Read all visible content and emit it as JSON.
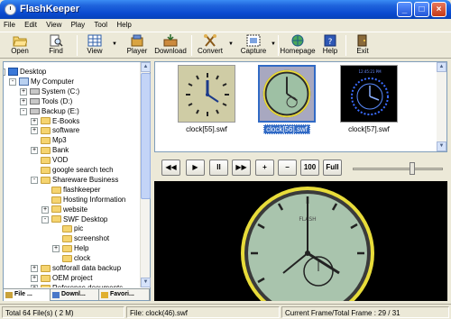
{
  "window": {
    "title": "FlashKeeper"
  },
  "menu": [
    "File",
    "Edit",
    "View",
    "Play",
    "Tool",
    "Help"
  ],
  "toolbar": {
    "open": "Open",
    "find": "Find",
    "view": "View",
    "player": "Player",
    "download": "Download",
    "convert": "Convert",
    "capture": "Capture",
    "homepage": "Homepage",
    "help": "Help",
    "exit": "Exit"
  },
  "tree": [
    {
      "label": "Desktop",
      "icon": "desktop-icon",
      "expand": "-"
    },
    {
      "label": "My Computer",
      "icon": "computer-icon",
      "expand": "-"
    },
    {
      "label": "System (C:)",
      "icon": "drive-icon",
      "expand": "+"
    },
    {
      "label": "Tools (D:)",
      "icon": "drive-icon",
      "expand": "+"
    },
    {
      "label": "Backup (E:)",
      "icon": "drive-icon",
      "expand": "-"
    },
    {
      "label": "E-Books",
      "icon": "folder-icon",
      "expand": "+"
    },
    {
      "label": "software",
      "icon": "folder-icon",
      "expand": "+"
    },
    {
      "label": "Mp3",
      "icon": "folder-icon",
      "expand": ""
    },
    {
      "label": "Bank",
      "icon": "folder-icon",
      "expand": "+"
    },
    {
      "label": "VOD",
      "icon": "folder-icon",
      "expand": ""
    },
    {
      "label": "google search tech",
      "icon": "folder-icon",
      "expand": ""
    },
    {
      "label": "Shareware Business",
      "icon": "folder-icon",
      "expand": "-"
    },
    {
      "label": "flashkeeper",
      "icon": "folder-icon",
      "expand": ""
    },
    {
      "label": "Hosting Information",
      "icon": "folder-icon",
      "expand": ""
    },
    {
      "label": "website",
      "icon": "folder-icon",
      "expand": "+"
    },
    {
      "label": "SWF Desktop",
      "icon": "folder-icon",
      "expand": "-"
    },
    {
      "label": "pic",
      "icon": "folder-icon",
      "expand": ""
    },
    {
      "label": "screenshot",
      "icon": "folder-icon",
      "expand": ""
    },
    {
      "label": "Help",
      "icon": "folder-icon",
      "expand": "+"
    },
    {
      "label": "clock",
      "icon": "folder-icon",
      "expand": ""
    },
    {
      "label": "softforall data backup",
      "icon": "folder-icon",
      "expand": "+"
    },
    {
      "label": "OEM project",
      "icon": "folder-icon",
      "expand": "+"
    },
    {
      "label": "Reference documents",
      "icon": "folder-icon",
      "expand": "+"
    }
  ],
  "tabs": [
    "File ...",
    "Downl...",
    "Favori..."
  ],
  "thumbnails": [
    {
      "label": "clock[55].swf",
      "selected": false
    },
    {
      "label": "clock[56].swf",
      "selected": true
    },
    {
      "label": "clock[57].swf",
      "selected": false
    }
  ],
  "thumb57_time": "12:45:21 PM",
  "controls": {
    "rewind": "◀◀",
    "play": "▶",
    "pause": "II",
    "forward": "▶▶",
    "zoom_in": "+",
    "zoom_out": "−",
    "actual": "100",
    "full": "Full"
  },
  "status": {
    "files": "Total 64 File(s)  ( 2 M)",
    "file": "File: clock(46).swf",
    "frames": "Current Frame/Total Frame : 29 / 31"
  },
  "colors": {
    "titlebar": "#0a4ad0",
    "selection": "#316ac5",
    "player_bg": "#000000",
    "clock_face": "#a9c4ad"
  }
}
